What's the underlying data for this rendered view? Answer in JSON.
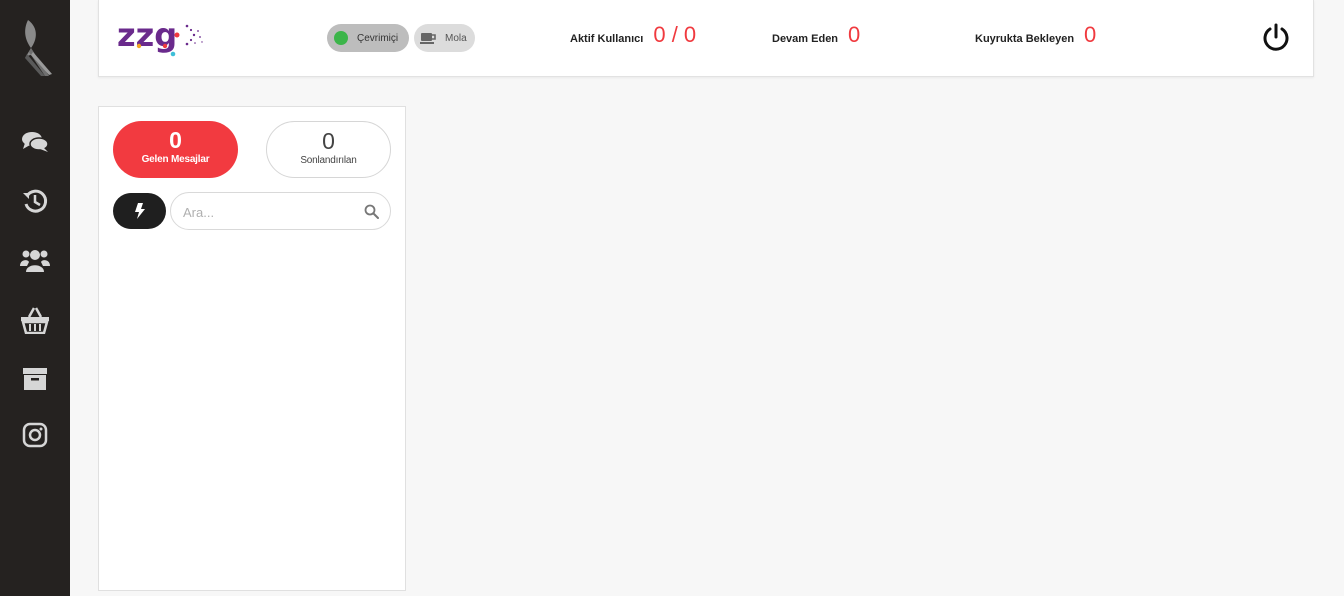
{
  "brand": {
    "logo_text": "zzg"
  },
  "status": {
    "online_label": "Çevrimiçi",
    "break_label": "Mola",
    "online_color": "#3cb54a"
  },
  "stats": {
    "active_users_label": "Aktif Kullanıcı",
    "active_users_value": "0 / 0",
    "in_progress_label": "Devam Eden",
    "in_progress_value": "0",
    "queue_label": "Kuyrukta Bekleyen",
    "queue_value": "0",
    "value_color": "#f03a3f"
  },
  "sidebar": {
    "items": [
      {
        "icon": "chat-icon"
      },
      {
        "icon": "history-icon"
      },
      {
        "icon": "users-icon"
      },
      {
        "icon": "basket-icon"
      },
      {
        "icon": "archive-icon"
      },
      {
        "icon": "instagram-icon"
      }
    ]
  },
  "panel": {
    "incoming_count": "0",
    "incoming_label": "Gelen Mesajlar",
    "closed_count": "0",
    "closed_label": "Sonlandırılan",
    "search_placeholder": "Ara...",
    "accent_color": "#f23a40"
  }
}
